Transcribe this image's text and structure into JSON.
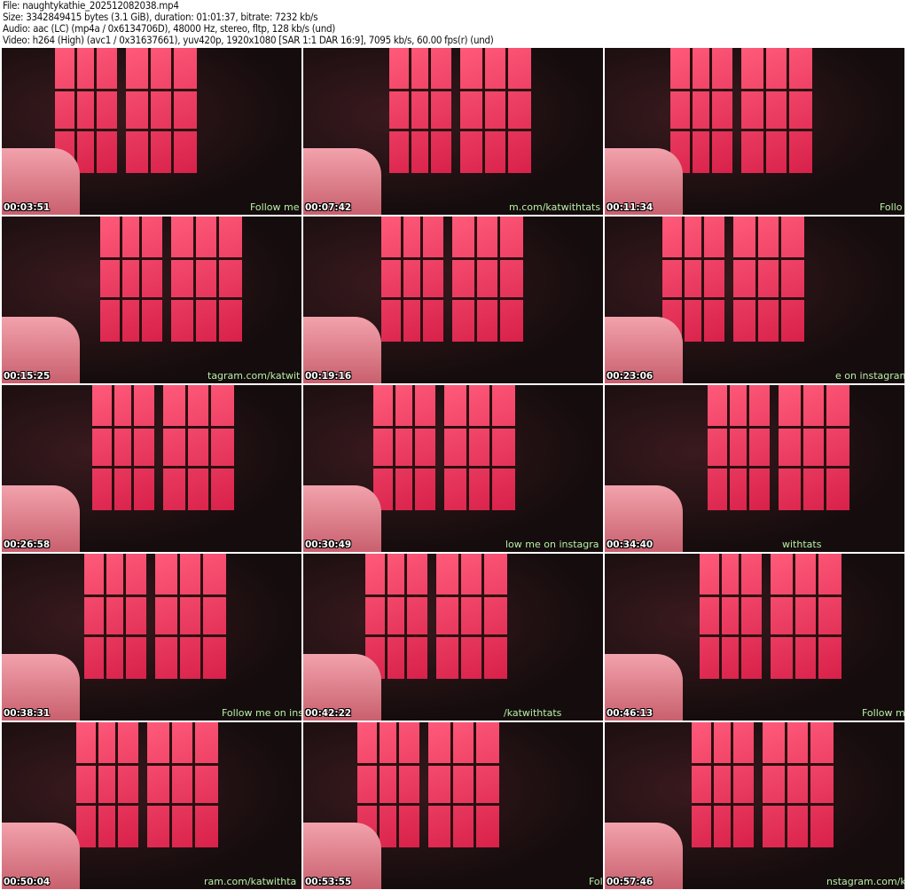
{
  "header": {
    "file": "File: naughtykathie_202512082038.mp4",
    "size": "Size: 3342849415 bytes (3.1 GiB), duration: 01:01:37, bitrate: 7232 kb/s",
    "audio": "Audio: aac (LC) (mp4a / 0x6134706D), 48000 Hz, stereo, fltp, 128 kb/s (und)",
    "video": "Video: h264 (High) (avc1 / 0x31637661), yuv420p, 1920x1080 [SAR 1:1 DAR 16:9], 7095 kb/s, 60.00 fps(r) (und)"
  },
  "thumbnails": [
    {
      "time": "00:03:51",
      "watermark": "Follow me o"
    },
    {
      "time": "00:07:42",
      "watermark": "m.com/katwithtats"
    },
    {
      "time": "00:11:34",
      "watermark": "Follo"
    },
    {
      "time": "00:15:25",
      "watermark": "tagram.com/katwit"
    },
    {
      "time": "00:19:16",
      "watermark": ""
    },
    {
      "time": "00:23:06",
      "watermark": "e on instagram.co"
    },
    {
      "time": "00:26:58",
      "watermark": ""
    },
    {
      "time": "00:30:49",
      "watermark": "low me on instagra"
    },
    {
      "time": "00:34:40",
      "watermark": "withtats"
    },
    {
      "time": "00:38:31",
      "watermark": "Follow me on ins"
    },
    {
      "time": "00:42:22",
      "watermark": "/katwithtats"
    },
    {
      "time": "00:46:13",
      "watermark": "Follow m"
    },
    {
      "time": "00:50:04",
      "watermark": "ram.com/katwithta"
    },
    {
      "time": "00:53:55",
      "watermark": "Fol"
    },
    {
      "time": "00:57:46",
      "watermark": "nstagram.com/katw"
    }
  ],
  "colors": {
    "panel": "#e8385e",
    "watermark": "#b6f0a6"
  }
}
